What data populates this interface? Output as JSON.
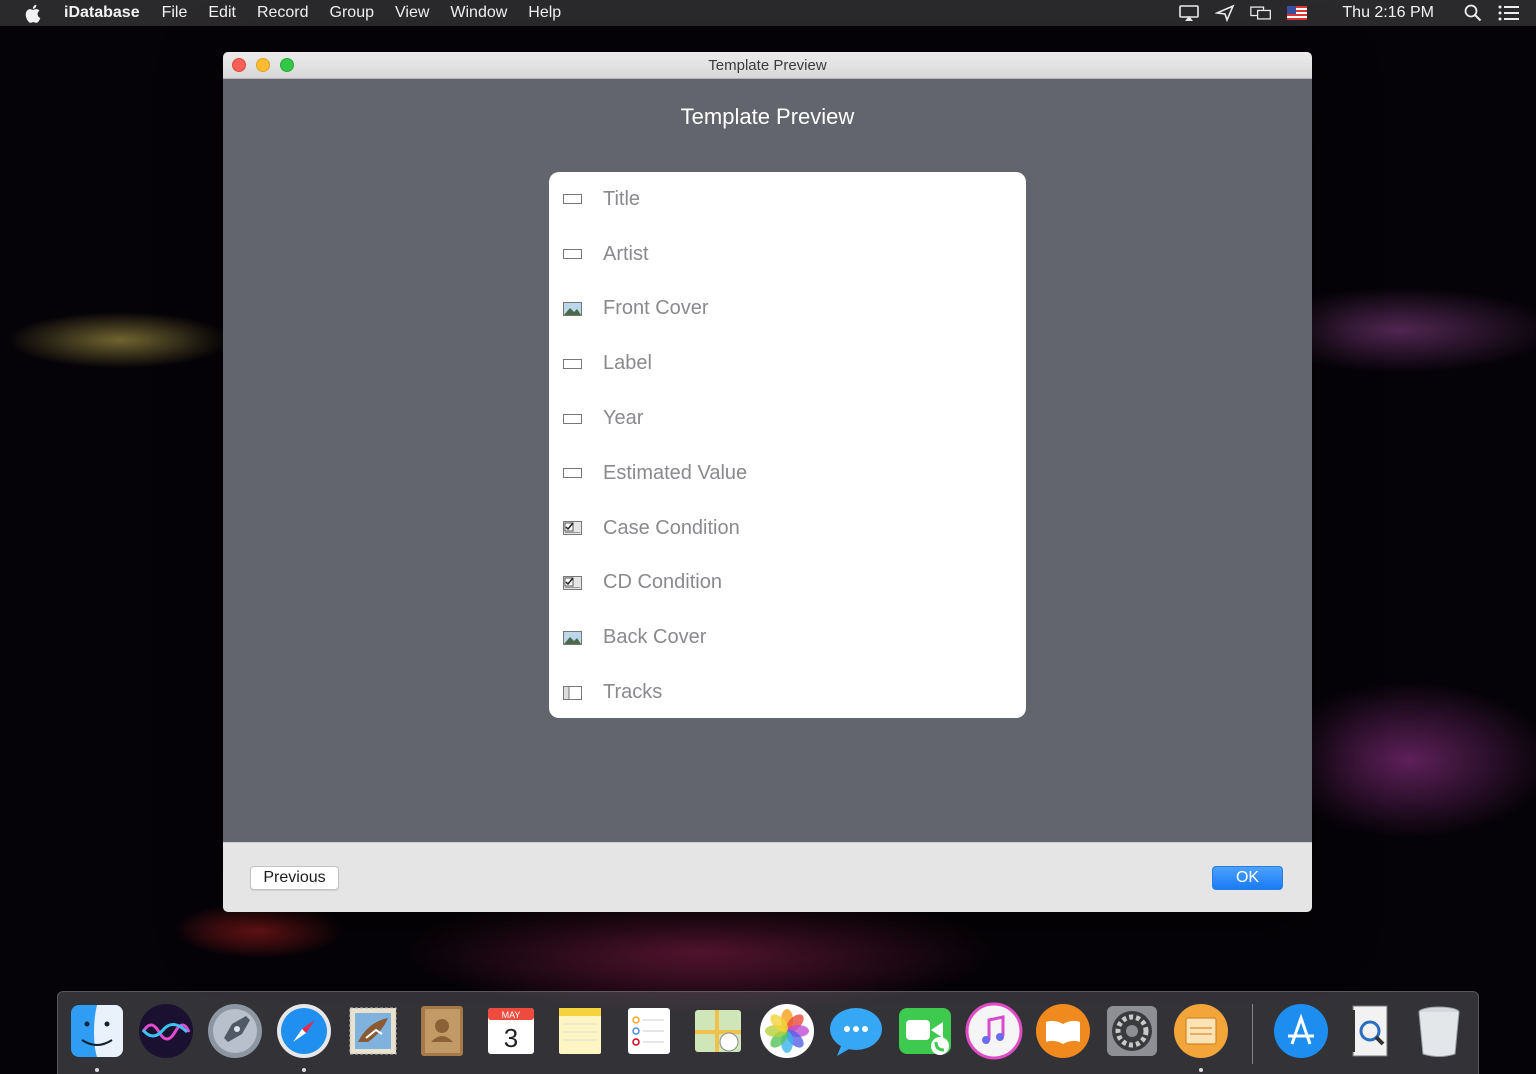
{
  "menubar": {
    "app_name": "iDatabase",
    "items": [
      "File",
      "Edit",
      "Record",
      "Group",
      "View",
      "Window",
      "Help"
    ],
    "clock": "Thu 2:16 PM"
  },
  "window": {
    "title": "Template Preview",
    "heading": "Template Preview",
    "fields": [
      {
        "label": "Title",
        "icon": "text-field-icon"
      },
      {
        "label": "Artist",
        "icon": "text-field-icon"
      },
      {
        "label": "Front Cover",
        "icon": "image-field-icon"
      },
      {
        "label": "Label",
        "icon": "text-field-icon"
      },
      {
        "label": "Year",
        "icon": "text-field-icon"
      },
      {
        "label": "Estimated Value",
        "icon": "text-field-icon"
      },
      {
        "label": "Case Condition",
        "icon": "checkbox-field-icon"
      },
      {
        "label": "CD Condition",
        "icon": "checkbox-field-icon"
      },
      {
        "label": "Back Cover",
        "icon": "image-field-icon"
      },
      {
        "label": "Tracks",
        "icon": "list-field-icon"
      }
    ],
    "buttons": {
      "previous": "Previous",
      "ok": "OK"
    }
  },
  "dock": {
    "calendar_month": "MAY",
    "calendar_day": "3",
    "apps": [
      "finder-icon",
      "siri-icon",
      "launchpad-icon",
      "safari-icon",
      "mail-icon",
      "contacts-icon",
      "calendar-icon",
      "notes-icon",
      "reminders-icon",
      "maps-icon",
      "photos-icon",
      "messages-icon",
      "facetime-icon",
      "itunes-icon",
      "ibooks-icon",
      "system-preferences-icon",
      "idatabase-icon",
      "app-store-icon",
      "preview-icon",
      "trash-icon"
    ]
  },
  "colors": {
    "window_bg": "#63656e",
    "accent_blue": "#1a7cf2"
  }
}
